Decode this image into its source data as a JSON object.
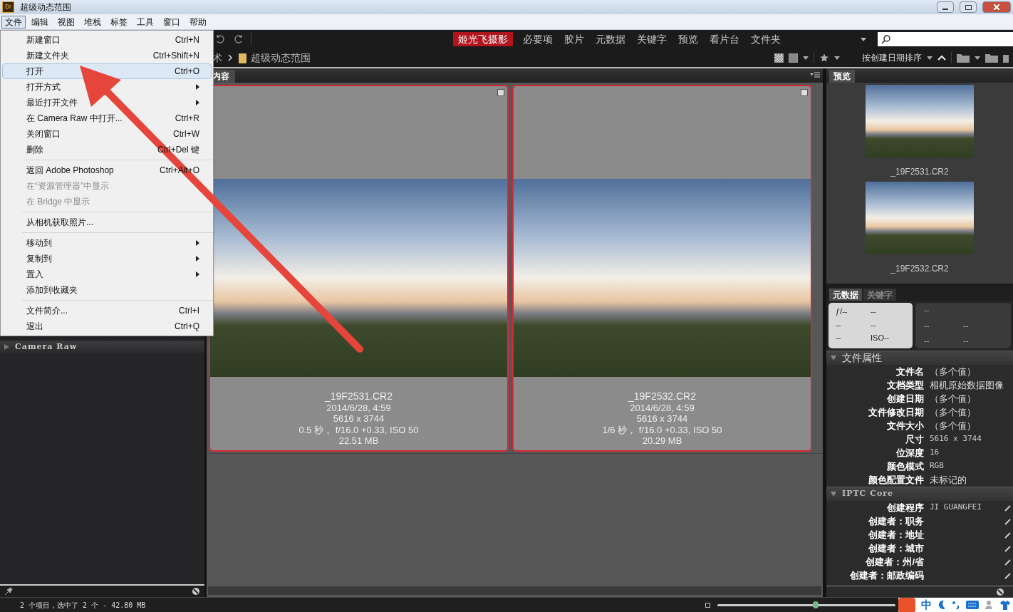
{
  "window": {
    "title": "超级动态范围",
    "logo": "Br"
  },
  "menubar": [
    {
      "label": "文件",
      "selected": true
    },
    {
      "label": "编辑",
      "selected": false
    },
    {
      "label": "视图",
      "selected": false
    },
    {
      "label": "堆栈",
      "selected": false
    },
    {
      "label": "标签",
      "selected": false
    },
    {
      "label": "工具",
      "selected": false
    },
    {
      "label": "窗口",
      "selected": false
    },
    {
      "label": "帮助",
      "selected": false
    }
  ],
  "file_menu": [
    {
      "kind": "item",
      "label": "新建窗口",
      "shortcut": "Ctrl+N",
      "highlighted": false,
      "disabled": false,
      "submenu": false
    },
    {
      "kind": "item",
      "label": "新建文件夹",
      "shortcut": "Ctrl+Shift+N",
      "highlighted": false,
      "disabled": false,
      "submenu": false
    },
    {
      "kind": "item",
      "label": "打开",
      "shortcut": "Ctrl+O",
      "highlighted": true,
      "disabled": false,
      "submenu": false
    },
    {
      "kind": "item",
      "label": "打开方式",
      "highlighted": false,
      "disabled": false,
      "submenu": true
    },
    {
      "kind": "item",
      "label": "最近打开文件",
      "highlighted": false,
      "disabled": false,
      "submenu": true
    },
    {
      "kind": "item",
      "label": "在 Camera Raw 中打开...",
      "shortcut": "Ctrl+R",
      "highlighted": false,
      "disabled": false,
      "submenu": false
    },
    {
      "kind": "item",
      "label": "关闭窗口",
      "shortcut": "Ctrl+W",
      "highlighted": false,
      "disabled": false,
      "submenu": false
    },
    {
      "kind": "item",
      "label": "删除",
      "shortcut": "Ctrl+Del 键",
      "highlighted": false,
      "disabled": false,
      "submenu": false
    },
    {
      "kind": "separator"
    },
    {
      "kind": "item",
      "label": "返回 Adobe Photoshop",
      "shortcut": "Ctrl+Alt+O",
      "highlighted": false,
      "disabled": false,
      "submenu": false
    },
    {
      "kind": "item",
      "label": "在“资源管理器”中显示",
      "highlighted": false,
      "disabled": true,
      "submenu": false
    },
    {
      "kind": "item",
      "label": "在 Bridge 中显示",
      "highlighted": false,
      "disabled": true,
      "submenu": false
    },
    {
      "kind": "separator"
    },
    {
      "kind": "item",
      "label": "从相机获取照片...",
      "highlighted": false,
      "disabled": false,
      "submenu": false
    },
    {
      "kind": "separator"
    },
    {
      "kind": "item",
      "label": "移动到",
      "highlighted": false,
      "disabled": false,
      "submenu": true
    },
    {
      "kind": "item",
      "label": "复制到",
      "highlighted": false,
      "disabled": false,
      "submenu": true
    },
    {
      "kind": "item",
      "label": "置入",
      "highlighted": false,
      "disabled": false,
      "submenu": true
    },
    {
      "kind": "item",
      "label": "添加到收藏夹",
      "highlighted": false,
      "disabled": false,
      "submenu": false
    },
    {
      "kind": "separator"
    },
    {
      "kind": "item",
      "label": "文件简介...",
      "shortcut": "Ctrl+I",
      "highlighted": false,
      "disabled": false,
      "submenu": false
    },
    {
      "kind": "item",
      "label": "退出",
      "shortcut": "Ctrl+Q",
      "highlighted": false,
      "disabled": false,
      "submenu": false
    }
  ],
  "workspaces": [
    {
      "label": "姬光飞摄影",
      "selected": true
    },
    {
      "label": "必要项",
      "selected": false
    },
    {
      "label": "胶片",
      "selected": false
    },
    {
      "label": "元数据",
      "selected": false
    },
    {
      "label": "关键字",
      "selected": false
    },
    {
      "label": "预览",
      "selected": false
    },
    {
      "label": "看片台",
      "selected": false
    },
    {
      "label": "文件夹",
      "selected": false
    }
  ],
  "breadcrumb": [
    "术",
    "超级动态范围"
  ],
  "sort": {
    "label": "按创建日期排序"
  },
  "left_panel": {
    "sections": [
      {
        "label": "Camera Raw",
        "expanded": false
      }
    ]
  },
  "content": {
    "tab": "内容",
    "thumbnails": [
      {
        "filename": "_19F2531.CR2",
        "date": "2014/6/28, 4:59",
        "dimensions": "5616 x 3744",
        "exposure": "0.5 秒， f/16.0 +0.33, ISO 50",
        "size": "22.51 MB",
        "selected": true
      },
      {
        "filename": "_19F2532.CR2",
        "date": "2014/6/28, 4:59",
        "dimensions": "5616 x 3744",
        "exposure": "1/6 秒， f/16.0 +0.33, ISO 50",
        "size": "20.29 MB",
        "selected": true
      }
    ]
  },
  "preview": {
    "tab": "预览",
    "items": [
      {
        "filename": "_19F2531.CR2"
      },
      {
        "filename": "_19F2532.CR2"
      }
    ]
  },
  "metadata": {
    "tabs": [
      {
        "label": "元数据",
        "selected": true
      },
      {
        "label": "关键字",
        "selected": false
      }
    ],
    "camera_left": [
      "ƒ/--",
      "--",
      "--",
      "--",
      "--",
      "ISO--"
    ],
    "camera_right": [
      [
        "--"
      ],
      [
        "--",
        "--"
      ],
      [
        "--",
        "--"
      ]
    ],
    "sections": [
      {
        "title": "文件属性",
        "expanded": true,
        "rows": [
          {
            "label": "文件名",
            "value": "（多个值）"
          },
          {
            "label": "文档类型",
            "value": "相机原始数据图像"
          },
          {
            "label": "创建日期",
            "value": "（多个值）"
          },
          {
            "label": "文件修改日期",
            "value": "（多个值）"
          },
          {
            "label": "文件大小",
            "value": "（多个值）"
          },
          {
            "label": "尺寸",
            "value": "5616 x 3744"
          },
          {
            "label": "位深度",
            "value": "16"
          },
          {
            "label": "颜色模式",
            "value": "RGB"
          },
          {
            "label": "颜色配置文件",
            "value": "未标记的"
          }
        ]
      },
      {
        "title": "IPTC Core",
        "expanded": true,
        "rows": [
          {
            "label": "创建程序",
            "value": "JI GUANGFEI",
            "editable": true
          },
          {
            "label": "创建者：职务",
            "editable": true
          },
          {
            "label": "创建者：地址",
            "editable": true
          },
          {
            "label": "创建者：城市",
            "editable": true
          },
          {
            "label": "创建者：州/省",
            "editable": true
          },
          {
            "label": "创建者：邮政编码",
            "editable": true
          }
        ]
      }
    ]
  },
  "status_bar": {
    "text": "2 个项目，选中了 2 个 - 42.80 MB",
    "zoom": {
      "level": 0.55
    },
    "ime": "中"
  }
}
